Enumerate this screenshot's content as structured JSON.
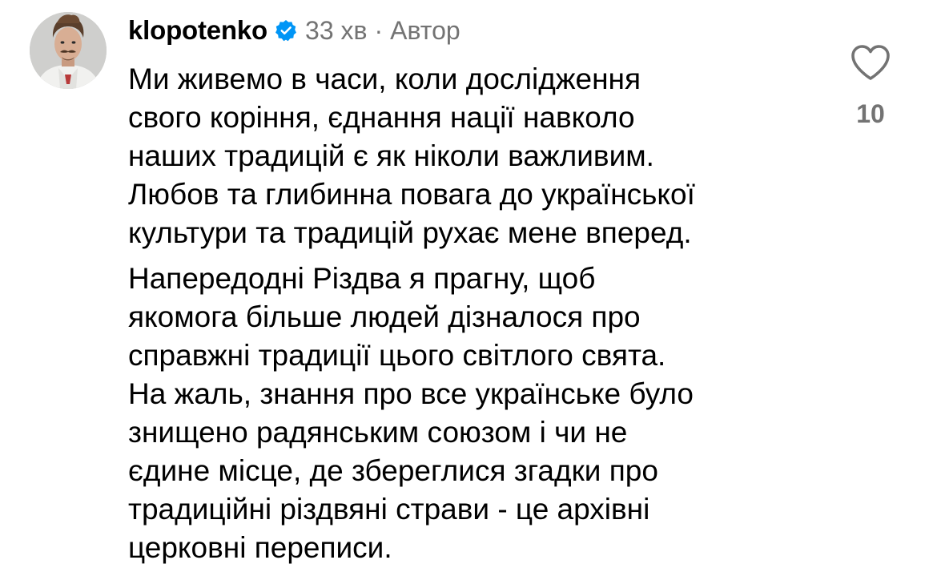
{
  "comment": {
    "author": {
      "username": "klopotenko",
      "verified": true,
      "avatar_icon": "profile-photo-avatar"
    },
    "time_ago": "33 хв",
    "separator": "·",
    "author_label": "Автор",
    "paragraphs": [
      {
        "lines": [
          "Ми живемо в часи, коли дослідження",
          "свого коріння, єднання нації навколо",
          "наших традицій є як ніколи важливим.",
          "Любов та глибинна повага до української",
          "культури та традицій рухає мене вперед."
        ]
      },
      {
        "lines": [
          "Напередодні Різдва я прагну, щоб",
          "якомога більше людей дізналося про",
          "справжні традиції цього світлого свята.",
          "На жаль, знання про все українське було",
          "знищено радянським союзом і чи не",
          "єдине місце, де збереглися згадки про",
          "традиційні різдвяні страви - це архівні",
          "церковні переписи."
        ]
      }
    ],
    "like": {
      "icon": "heart-outline-icon",
      "count": "10"
    }
  },
  "colors": {
    "text": "#000000",
    "secondary_text": "#737373",
    "verified_badge": "#0095F6",
    "background": "#FFFFFF"
  }
}
